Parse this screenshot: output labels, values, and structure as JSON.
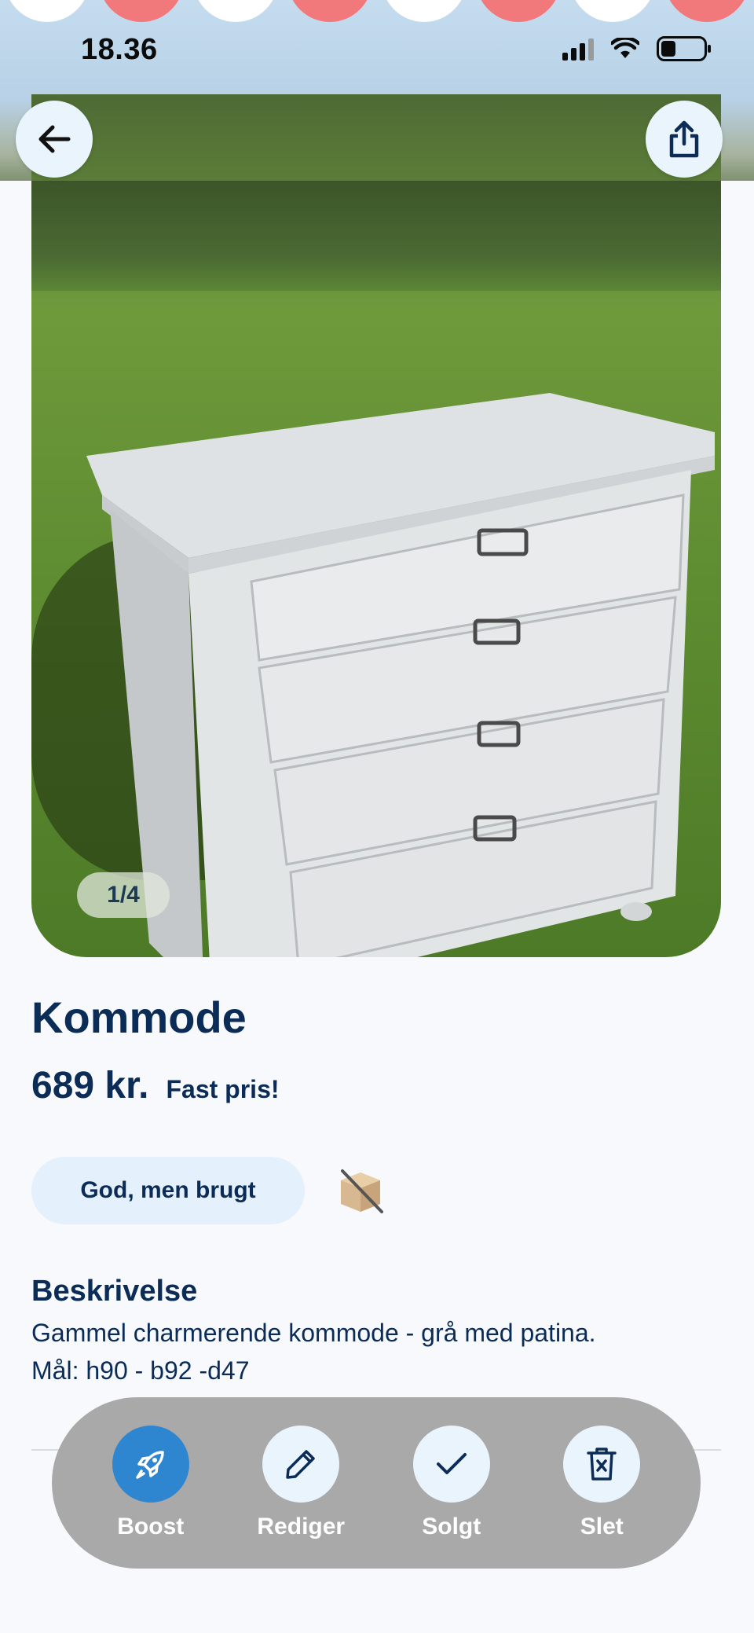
{
  "status_bar": {
    "time": "18.36"
  },
  "gallery": {
    "counter": "1/4"
  },
  "listing": {
    "title": "Kommode",
    "price": "689 kr.",
    "price_note": "Fast pris!",
    "condition": "God, men brugt",
    "description_heading": "Beskrivelse",
    "description_lines": [
      "Gammel charmerende kommode - grå med patina.",
      "Mål: h90 - b92 -d47"
    ]
  },
  "actions": [
    {
      "label": "Boost",
      "icon": "rocket-icon"
    },
    {
      "label": "Rediger",
      "icon": "pencil-icon"
    },
    {
      "label": "Solgt",
      "icon": "checkmark-icon"
    },
    {
      "label": "Slet",
      "icon": "trash-icon"
    }
  ],
  "colors": {
    "primary": "#2f86d0",
    "text": "#0b2c57",
    "chip_bg": "#e4f0fb",
    "action_bar_bg": "#a9a9a9"
  }
}
